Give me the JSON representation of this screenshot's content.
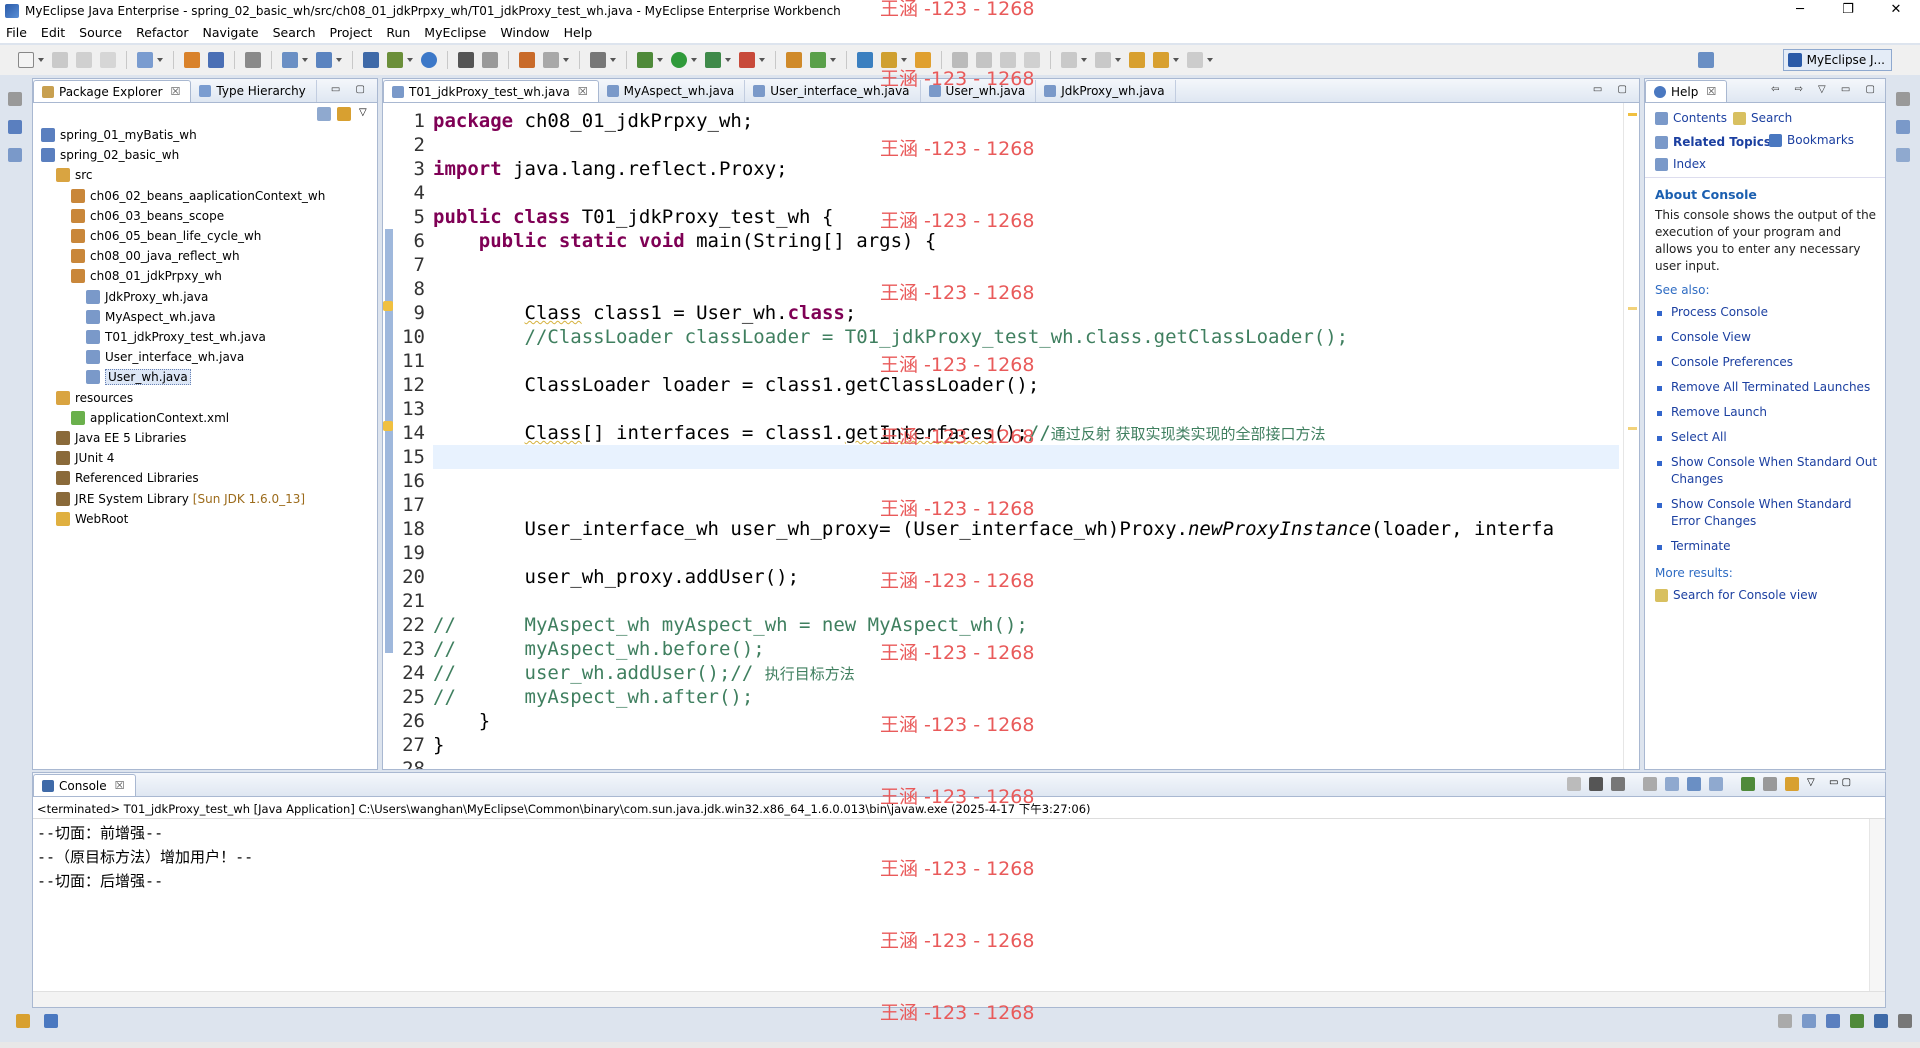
{
  "window": {
    "title": "MyEclipse Java Enterprise - spring_02_basic_wh/src/ch08_01_jdkPrpxy_wh/T01_jdkProxy_test_wh.java - MyEclipse Enterprise Workbench",
    "min": "─",
    "max": "❐",
    "close": "✕"
  },
  "menu": [
    "File",
    "Edit",
    "Source",
    "Refactor",
    "Navigate",
    "Search",
    "Project",
    "Run",
    "MyEclipse",
    "Window",
    "Help"
  ],
  "perspective": {
    "label": "MyEclipse J..."
  },
  "package_explorer": {
    "tabs": [
      {
        "label": "Package Explorer",
        "close": "☒"
      },
      {
        "label": "Type Hierarchy"
      }
    ],
    "tree": [
      {
        "label": "spring_01_myBatis_wh",
        "depth": 1,
        "icon": "project-icon"
      },
      {
        "label": "spring_02_basic_wh",
        "depth": 1,
        "icon": "project-icon"
      },
      {
        "label": "src",
        "depth": 2,
        "icon": "source-folder-icon"
      },
      {
        "label": "ch06_02_beans_aaplicationContext_wh",
        "depth": 3,
        "icon": "package-icon"
      },
      {
        "label": "ch06_03_beans_scope",
        "depth": 3,
        "icon": "package-icon"
      },
      {
        "label": "ch06_05_bean_life_cycle_wh",
        "depth": 3,
        "icon": "package-icon"
      },
      {
        "label": "ch08_00_java_reflect_wh",
        "depth": 3,
        "icon": "package-icon"
      },
      {
        "label": "ch08_01_jdkPrpxy_wh",
        "depth": 3,
        "icon": "package-icon"
      },
      {
        "label": "JdkProxy_wh.java",
        "depth": 4,
        "icon": "java-file-icon"
      },
      {
        "label": "MyAspect_wh.java",
        "depth": 4,
        "icon": "java-file-icon"
      },
      {
        "label": "T01_jdkProxy_test_wh.java",
        "depth": 4,
        "icon": "java-file-icon"
      },
      {
        "label": "User_interface_wh.java",
        "depth": 4,
        "icon": "java-file-icon"
      },
      {
        "label": "User_wh.java",
        "depth": 4,
        "icon": "java-file-icon",
        "selected": true
      },
      {
        "label": "resources",
        "depth": 2,
        "icon": "source-folder-icon"
      },
      {
        "label": "applicationContext.xml",
        "depth": 3,
        "icon": "xml-file-icon"
      },
      {
        "label": "Java EE 5 Libraries",
        "depth": 2,
        "icon": "library-icon"
      },
      {
        "label": "JUnit 4",
        "depth": 2,
        "icon": "library-icon"
      },
      {
        "label": "Referenced Libraries",
        "depth": 2,
        "icon": "library-icon"
      },
      {
        "label": "JRE System Library",
        "depth": 2,
        "icon": "library-icon",
        "decoration": "[Sun JDK 1.6.0_13]"
      },
      {
        "label": "WebRoot",
        "depth": 2,
        "icon": "folder-icon"
      }
    ]
  },
  "editor": {
    "tabs": [
      {
        "label": "T01_jdkProxy_test_wh.java",
        "active": true,
        "close": "☒"
      },
      {
        "label": "MyAspect_wh.java"
      },
      {
        "label": "User_interface_wh.java"
      },
      {
        "label": "User_wh.java"
      },
      {
        "label": "JdkProxy_wh.java"
      }
    ],
    "line_numbers": [
      "1",
      "2",
      "3",
      "4",
      "5",
      "6",
      "7",
      "8",
      "9",
      "10",
      "11",
      "12",
      "13",
      "14",
      "15",
      "16",
      "17",
      "18",
      "19",
      "20",
      "21",
      "22",
      "23",
      "24",
      "25",
      "26",
      "27",
      "28"
    ],
    "current_line": 15,
    "lines": [
      [
        {
          "t": "kw",
          "v": "package"
        },
        {
          "t": "",
          "v": " ch08_01_jdkPrpxy_wh;"
        }
      ],
      [],
      [
        {
          "t": "kw",
          "v": "import"
        },
        {
          "t": "",
          "v": " java.lang.reflect.Proxy;"
        }
      ],
      [],
      [
        {
          "t": "kw",
          "v": "public class"
        },
        {
          "t": "",
          "v": " T01_jdkProxy_test_wh {"
        }
      ],
      [
        {
          "t": "",
          "v": "    "
        },
        {
          "t": "kw",
          "v": "public static void"
        },
        {
          "t": "",
          "v": " main(String[] args) {"
        }
      ],
      [],
      [],
      [
        {
          "t": "",
          "v": "        "
        },
        {
          "t": "warn",
          "v": "Class"
        },
        {
          "t": "",
          "v": " class1 = User_wh."
        },
        {
          "t": "kw",
          "v": "class"
        },
        {
          "t": "",
          "v": ";"
        }
      ],
      [
        {
          "t": "",
          "v": "        "
        },
        {
          "t": "cm",
          "v": "//ClassLoader classLoader = T01_jdkProxy_test_wh.class.getClassLoader();"
        }
      ],
      [],
      [
        {
          "t": "",
          "v": "        ClassLoader loader = class1.getClassLoader();"
        }
      ],
      [],
      [
        {
          "t": "",
          "v": "        "
        },
        {
          "t": "warn",
          "v": "Class"
        },
        {
          "t": "",
          "v": "[] interfaces = class1."
        },
        {
          "t": "warn",
          "v": "getInterfaces"
        },
        {
          "t": "",
          "v": "();"
        },
        {
          "t": "cm",
          "v": "//"
        },
        {
          "t": "cm cjk",
          "v": "通过反射 获取实现类实现的全部接口方法"
        }
      ],
      [],
      [],
      [],
      [
        {
          "t": "",
          "v": "        User_interface_wh user_wh_proxy= (User_interface_wh)Proxy."
        },
        {
          "t": "it",
          "v": "newProxyInstance"
        },
        {
          "t": "",
          "v": "(loader, interfa"
        }
      ],
      [],
      [
        {
          "t": "",
          "v": "        user_wh_proxy.addUser();"
        }
      ],
      [],
      [
        {
          "t": "cm",
          "v": "//      MyAspect_wh myAspect_wh = new MyAspect_wh();"
        }
      ],
      [
        {
          "t": "cm",
          "v": "//      myAspect_wh.before();"
        }
      ],
      [
        {
          "t": "cm",
          "v": "//      user_wh.addUser();// "
        },
        {
          "t": "cm cjk",
          "v": "执行目标方法"
        }
      ],
      [
        {
          "t": "cm",
          "v": "//      myAspect_wh.after();"
        }
      ],
      [
        {
          "t": "",
          "v": "    }"
        }
      ],
      [
        {
          "t": "",
          "v": "}"
        }
      ],
      []
    ]
  },
  "help": {
    "tab": {
      "label": "Help",
      "close": "☒"
    },
    "nav": {
      "contents": "Contents",
      "search": "Search",
      "related": "Related Topics",
      "bookmarks": "Bookmarks",
      "index": "Index"
    },
    "about_title": "About Console",
    "about_text": [
      "This console shows the output of the",
      "execution of your program and",
      "allows you to enter any necessary",
      "user input."
    ],
    "see_also": "See also:",
    "links": [
      [
        "Process Console"
      ],
      [
        "Console View"
      ],
      [
        "Console Preferences"
      ],
      [
        "Remove All Terminated Launches"
      ],
      [
        "Remove Launch"
      ],
      [
        "Select All"
      ],
      [
        "Show Console When Standard Out",
        "Changes"
      ],
      [
        "Show Console When Standard",
        "Error Changes"
      ],
      [
        "Terminate"
      ]
    ],
    "more_results": "More results:",
    "search_for": "Search for Console view"
  },
  "console": {
    "tab": {
      "label": "Console",
      "close": "☒"
    },
    "header": "<terminated> T01_jdkProxy_test_wh [Java Application] C:\\Users\\wanghan\\MyEclipse\\Common\\binary\\com.sun.java.jdk.win32.x86_64_1.6.0.013\\bin\\javaw.exe (2025-4-17 下午3:27:06)",
    "output": [
      "--切面：前增强--",
      "--（原目标方法）增加用户！--",
      "--切面：后增强--"
    ]
  },
  "watermark": "王涵 -123 - 1268",
  "colors": {
    "keyword": "#7f0055",
    "comment": "#3f7f5f",
    "watermark": "#e95a5a",
    "link": "#1b3fa0"
  }
}
